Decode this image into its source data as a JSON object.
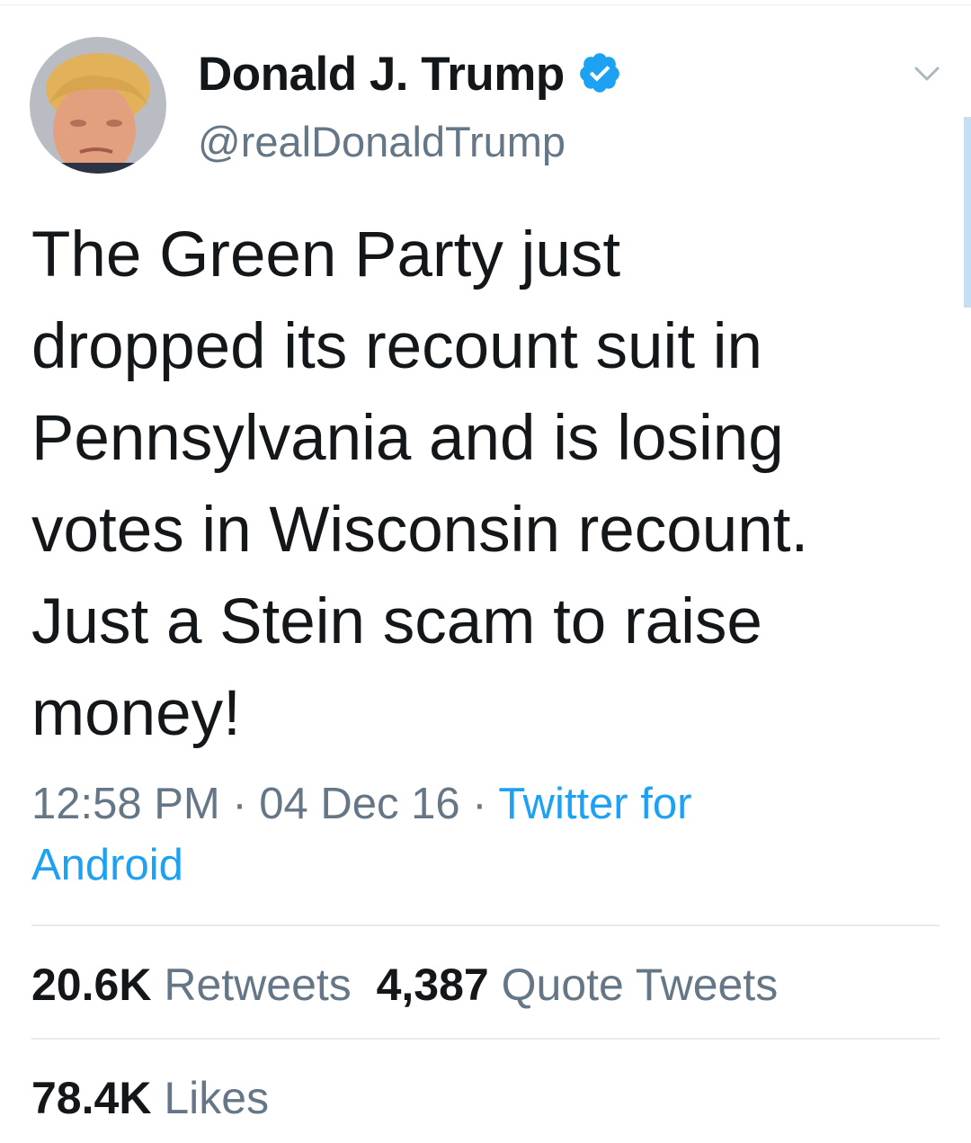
{
  "author": {
    "display_name": "Donald J. Trump",
    "screen_name": "@realDonaldTrump",
    "verified": true
  },
  "tweet": {
    "text_lines": [
      "The Green Party just",
      "dropped its recount suit in",
      "Pennsylvania and is losing",
      "votes in Wisconsin recount.",
      "Just a Stein scam to raise",
      "money!"
    ]
  },
  "meta": {
    "time": "12:58 PM",
    "separator": " · ",
    "date": "04 Dec 16",
    "source_part1": "Twitter for",
    "source_part2": "Android"
  },
  "stats": {
    "retweets_count": "20.6K",
    "retweets_label": "Retweets",
    "quotes_count": "4,387",
    "quotes_label": "Quote Tweets",
    "likes_count": "78.4K",
    "likes_label": "Likes"
  },
  "colors": {
    "text": "#14171a",
    "secondary": "#657786",
    "link": "#1da1f2",
    "divider": "#e6ecf0"
  },
  "icons": {
    "verified": "verified-badge-icon",
    "caret": "chevron-down-icon"
  }
}
